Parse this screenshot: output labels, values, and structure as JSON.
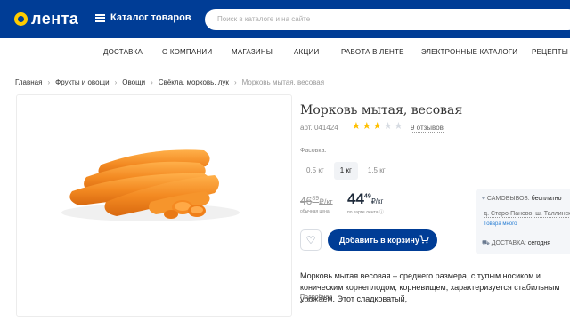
{
  "header": {
    "logo_text": "лента",
    "catalog_label": "Каталог товаров",
    "search_placeholder": "Поиск в каталоге и на сайте"
  },
  "nav": {
    "items": [
      "ДОСТАВКА",
      "О КОМПАНИИ",
      "МАГАЗИНЫ",
      "АКЦИИ",
      "РАБОТА В ЛЕНТЕ",
      "ЭЛЕКТРОННЫЕ КАТАЛОГИ",
      "РЕЦЕПТЫ"
    ]
  },
  "breadcrumb": {
    "items": [
      "Главная",
      "Фрукты и овощи",
      "Овощи",
      "Свёкла, морковь, лук",
      "Морковь мытая, весовая"
    ],
    "separator": "›"
  },
  "product": {
    "title": "Морковь мытая, весовая",
    "article": "арт. 041424",
    "rating": 3,
    "rating_max": 5,
    "reviews": "9 отзывов",
    "pack_label": "Фасовка:",
    "pack_options": [
      "0.5 кг",
      "1 кг",
      "1.5 кг"
    ],
    "pack_selected": "1 кг",
    "old_price_int": "46",
    "old_price_frac": "89",
    "old_price_unit": "₽/кг",
    "old_price_caption": "обычная цена",
    "new_price_int": "44",
    "new_price_frac": "49",
    "new_price_unit": "₽/кг",
    "new_price_caption": "по карте лента ⓘ",
    "cart_label": "Добавить в корзину",
    "description": "Морковь мытая весовая – среднего размера, с тупым носиком и коническим корнеплодом, корневищем, характеризуется стабильным урожаем. Этот сладковатый,",
    "more_label": "Подробнее"
  },
  "delivery": {
    "pickup_label": "САМОВЫВОЗ:",
    "pickup_value": "бесплатно",
    "address": "д. Старо-Паново, ш. Таллинское",
    "stock": "Товара много",
    "delivery_label": "ДОСТАВКА:",
    "delivery_value": "сегодня"
  },
  "colors": {
    "brand_blue": "#003d96",
    "logo_yellow": "#ffcc00",
    "star_active": "#ffc000",
    "star_inactive": "#d6dbe2",
    "carrot": "#f38a22"
  }
}
